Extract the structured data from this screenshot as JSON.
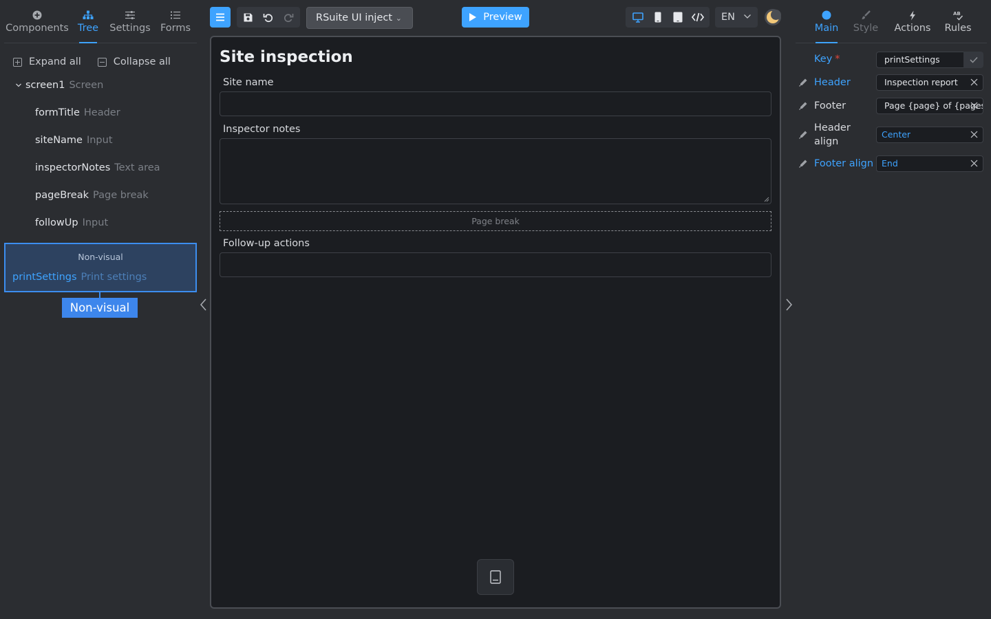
{
  "colors": {
    "accent": "#3ea3ff",
    "background": "#2b2d31",
    "canvas": "#1b1d21",
    "selection": "#3c8ef0"
  },
  "left_tabs": [
    {
      "label": "Components",
      "icon": "plus-circle-icon"
    },
    {
      "label": "Tree",
      "icon": "tree-icon",
      "active": true
    },
    {
      "label": "Settings",
      "icon": "sliders-icon"
    },
    {
      "label": "Forms",
      "icon": "list-icon"
    }
  ],
  "tree": {
    "expand_all": "Expand all",
    "collapse_all": "Collapse all",
    "root": {
      "name": "screen1",
      "type": "Screen"
    },
    "children": [
      {
        "name": "formTitle",
        "type": "Header"
      },
      {
        "name": "siteName",
        "type": "Input"
      },
      {
        "name": "inspectorNotes",
        "type": "Text area"
      },
      {
        "name": "pageBreak",
        "type": "Page break"
      },
      {
        "name": "followUp",
        "type": "Input"
      }
    ],
    "non_visual": {
      "title": "Non-visual",
      "item": {
        "name": "printSettings",
        "type": "Print settings"
      },
      "tag": "Non-visual"
    }
  },
  "toolbar": {
    "theme_select": "RSuite UI inject",
    "preview": "Preview",
    "language": "EN"
  },
  "form": {
    "title": "Site inspection",
    "fields": [
      {
        "label": "Site name",
        "value": ""
      },
      {
        "label": "Inspector notes",
        "value": ""
      },
      {
        "label": "Follow-up actions",
        "value": ""
      }
    ],
    "page_break": "Page break"
  },
  "right_tabs": [
    {
      "label": "Main",
      "icon": "dot-icon",
      "active": true
    },
    {
      "label": "Style",
      "icon": "brush-icon",
      "disabled": true
    },
    {
      "label": "Actions",
      "icon": "bolt-icon"
    },
    {
      "label": "Rules",
      "icon": "ab-check-icon"
    }
  ],
  "properties": {
    "key": {
      "label": "Key",
      "required_mark": "*",
      "value": "printSettings"
    },
    "header": {
      "label": "Header",
      "value": "Inspection report"
    },
    "footer": {
      "label": "Footer",
      "value": "Page {page} of {pages}"
    },
    "header_align": {
      "label": "Header align",
      "value": "Center"
    },
    "footer_align": {
      "label": "Footer align",
      "value": "End"
    }
  }
}
